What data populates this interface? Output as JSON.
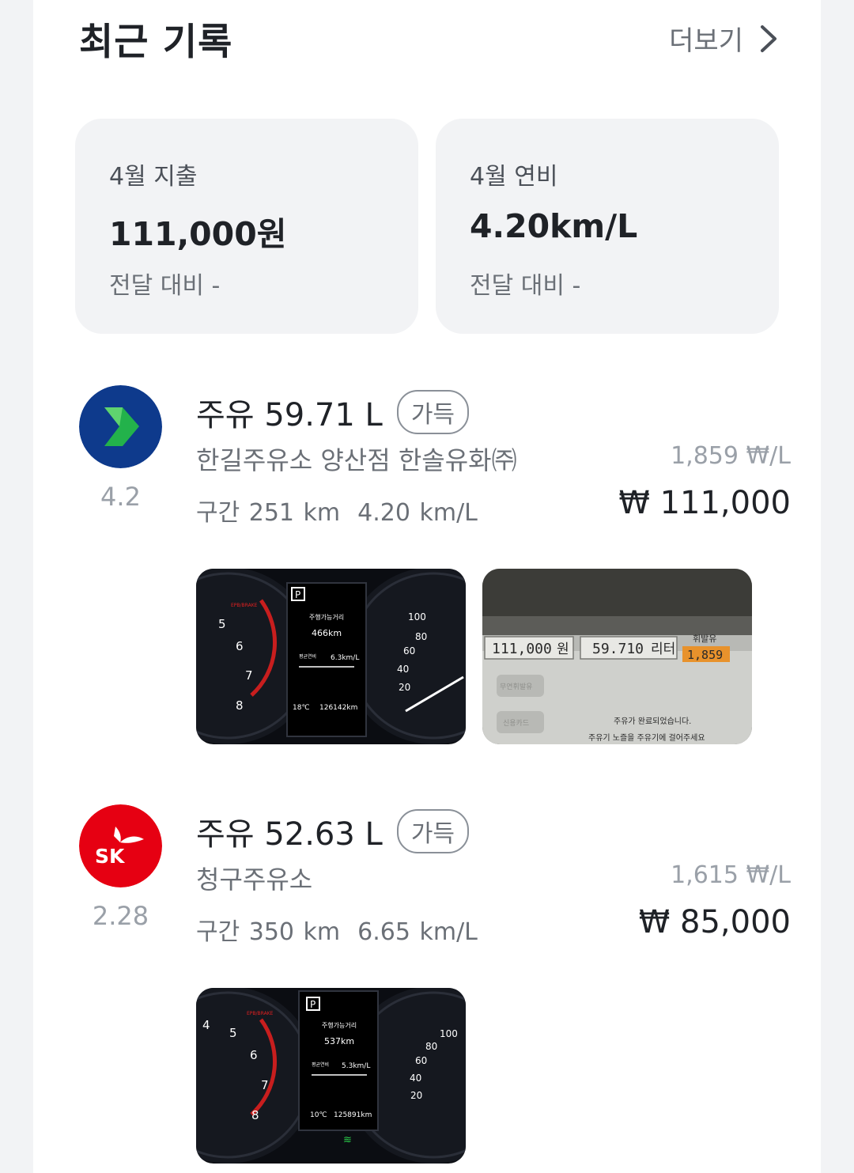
{
  "header": {
    "title": "최근 기록",
    "more_label": "더보기",
    "more_icon": "chevron-right-icon"
  },
  "summary": [
    {
      "label": "4월 지출",
      "value": "111,000원",
      "compare": "전달 대비 -"
    },
    {
      "label": "4월 연비",
      "value": "4.20km/L",
      "compare": "전달 대비 -"
    }
  ],
  "records": [
    {
      "brand_icon": "gs-caltex-logo-icon",
      "brand_color": "#0e3a8c",
      "rating": "4.2",
      "amount": "주유 59.71 L",
      "badge": "가득",
      "station": "한길주유소 양산점 한솔유화㈜",
      "segment_distance": "구간 251 km",
      "segment_efficiency": "4.20 km/L",
      "unit_price": "1,859 ₩/L",
      "total": "₩ 111,000",
      "photos": [
        {
          "kind": "dashboard",
          "top_text": "주행가능거리",
          "range": "466km",
          "avg_label": "평균연비",
          "avg": "6.3km/L",
          "temp": "18℃",
          "odometer": "126142km",
          "brake": "EPB/BRAKE"
        },
        {
          "kind": "pump",
          "price_value": "111,000",
          "price_unit": "원",
          "volume_value": "59.710",
          "volume_unit": "리터",
          "fuel_type": "휘발유",
          "unit_price": "1,859",
          "msg1": "주유가 완료되었습니다.",
          "msg2": "주유기 노즐을 주유기에 걸어주세요",
          "btn1": "무연휘발유",
          "btn2": "신용카드"
        }
      ]
    },
    {
      "brand_icon": "sk-energy-logo-icon",
      "brand_color": "#e60012",
      "brand_text": "SK",
      "rating": "2.28",
      "amount": "주유 52.63 L",
      "badge": "가득",
      "station": "청구주유소",
      "segment_distance": "구간 350 km",
      "segment_efficiency": "6.65 km/L",
      "unit_price": "1,615 ₩/L",
      "total": "₩ 85,000",
      "photos": [
        {
          "kind": "dashboard",
          "top_text": "주행가능거리",
          "range": "537km",
          "avg_label": "평균연비",
          "avg": "5.3km/L",
          "temp": "10℃",
          "odometer": "125891km",
          "brake": "EPB/BRAKE"
        }
      ]
    }
  ]
}
